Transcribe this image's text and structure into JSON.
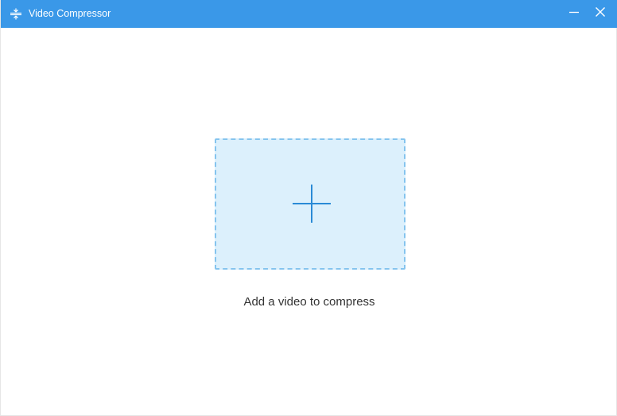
{
  "window": {
    "title": "Video Compressor",
    "icon": "compress-icon",
    "controls": {
      "minimize_icon": "minimize-icon",
      "close_icon": "close-icon"
    }
  },
  "main": {
    "dropzone_icon": "plus-icon",
    "hint": "Add a video to compress"
  },
  "colors": {
    "titlebar": "#3a98e8",
    "dropzone_fill": "#dcf0fc",
    "dropzone_border": "#85c4ee",
    "plus": "#2a8ad6"
  }
}
